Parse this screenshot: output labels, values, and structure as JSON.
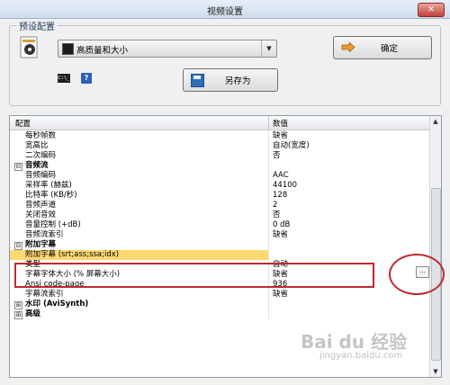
{
  "window": {
    "title": "视频设置",
    "close_glyph": "✕"
  },
  "presets": {
    "group_label": "预设配置",
    "selected": "高质量和大小",
    "dropdown_icon": "chevron-down-icon",
    "ok_label": "确定",
    "save_as_label": "另存为",
    "cmd_icon_text": "C:\\_",
    "help_icon_text": "?"
  },
  "grid": {
    "header_config": "配置",
    "header_value": "数值",
    "rows": [
      {
        "type": "item",
        "name": "每秒帧数",
        "value": "缺省"
      },
      {
        "type": "item",
        "name": "宽高比",
        "value": "自动(宽度)"
      },
      {
        "type": "item",
        "name": "二次编码",
        "value": "否"
      },
      {
        "type": "category",
        "expander": "⊟",
        "name": "音频流",
        "value": ""
      },
      {
        "type": "item",
        "name": "音频编码",
        "value": "AAC"
      },
      {
        "type": "item",
        "name": "采样率 (赫兹)",
        "value": "44100"
      },
      {
        "type": "item",
        "name": "比特率 (KB/秒)",
        "value": "128"
      },
      {
        "type": "item",
        "name": "音频声道",
        "value": "2"
      },
      {
        "type": "item",
        "name": "关闭音效",
        "value": "否"
      },
      {
        "type": "item",
        "name": "音量控制 (+dB)",
        "value": "0 dB"
      },
      {
        "type": "item",
        "name": "音频流索引",
        "value": "缺省"
      },
      {
        "type": "category",
        "expander": "⊟",
        "name": "附加字幕",
        "value": ""
      },
      {
        "type": "item",
        "name": "附加字幕 (srt;ass;ssa;idx)",
        "value": "",
        "selected": true,
        "ellipsis": "..."
      },
      {
        "type": "item",
        "name": "类型",
        "value": "自动"
      },
      {
        "type": "item",
        "name": "字幕字体大小 (% 屏幕大小)",
        "value": "缺省"
      },
      {
        "type": "item",
        "name": "Ansi code-page",
        "value": "936"
      },
      {
        "type": "item",
        "name": "字幕流索引",
        "value": "缺省"
      },
      {
        "type": "category",
        "expander": "⊞",
        "name": "水印 (AviSynth)",
        "value": ""
      },
      {
        "type": "category",
        "expander": "⊞",
        "name": "高级",
        "value": ""
      }
    ]
  },
  "watermark": {
    "text": "Bai du 经验",
    "sub": "jingyan.baidu.com"
  },
  "colors": {
    "highlight_row": "#ffd870",
    "annotation_red": "#c0282e",
    "title_bar": "#cfdcec"
  }
}
